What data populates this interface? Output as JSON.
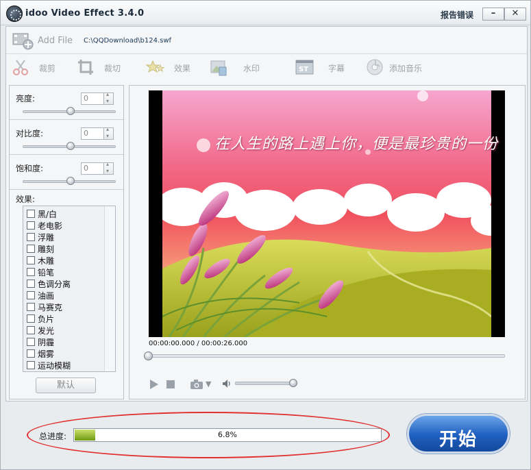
{
  "window": {
    "title": "idoo Video Effect 3.4.0",
    "report_link": "报告错误",
    "minimize_label": "–",
    "close_label": "✕"
  },
  "toolbar": {
    "add_file_label": "Add File",
    "file_path": "C:\\QQDownload\\b124.swf",
    "tools": [
      {
        "label": "裁剪",
        "icon": "scissors-icon"
      },
      {
        "label": "裁切",
        "icon": "crop-icon"
      },
      {
        "label": "效果",
        "icon": "stars-icon"
      },
      {
        "label": "水印",
        "icon": "watermark-icon"
      },
      {
        "label": "字幕",
        "icon": "subtitle-icon"
      },
      {
        "label": "添加音乐",
        "icon": "music-disc-icon"
      }
    ]
  },
  "adjustments": [
    {
      "label": "亮度:",
      "value": "0",
      "level": 0.5
    },
    {
      "label": "对比度:",
      "value": "0",
      "level": 0.5
    },
    {
      "label": "饱和度:",
      "value": "0",
      "level": 0.5
    }
  ],
  "effects": {
    "title": "效果:",
    "items": [
      "黑/白",
      "老电影",
      "浮雕",
      "雕刻",
      "木雕",
      "铅笔",
      "色调分离",
      "油画",
      "马赛克",
      "负片",
      "发光",
      "阴霾",
      "烟雾",
      "运动模糊"
    ],
    "default_button": "默认"
  },
  "preview": {
    "caption": "在人生的路上遇上你，便是最珍贵的一份 情缘",
    "timecode": "00:00:00.000 / 00:00:26.000",
    "seek_position": 0,
    "volume_level": 1.0
  },
  "progress": {
    "label": "总进度:",
    "value_text": "6.8%",
    "fraction": 0.068
  },
  "start_button": {
    "label": "开始"
  },
  "colors": {
    "accent_blue": "#1e5fbf",
    "progress_green": "#6f9a12",
    "annotation_red": "#e03030"
  }
}
